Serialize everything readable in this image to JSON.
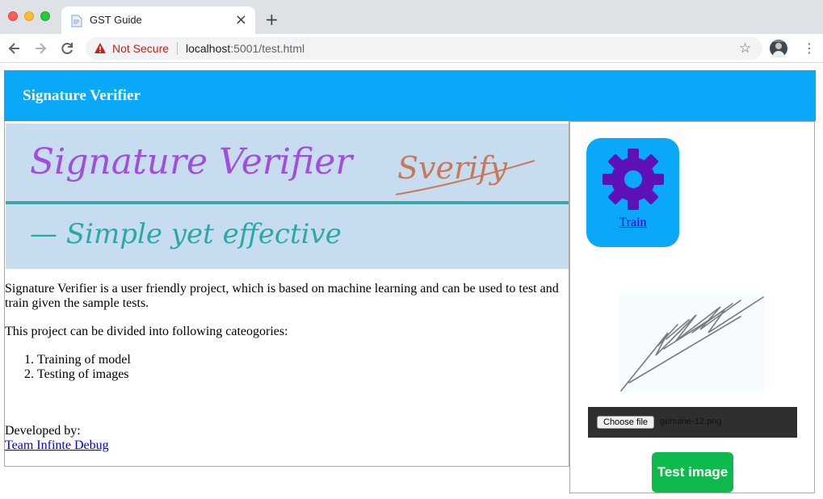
{
  "browser": {
    "tab_title": "GST Guide",
    "tab_close": "×",
    "new_tab": "+",
    "security_label": "Not Secure",
    "url_host": "localhost",
    "url_rest": ":5001/test.html",
    "bookmark_icon": "star-icon",
    "menu": "⋮"
  },
  "header": {
    "title": "Signature Verifier"
  },
  "banner": {
    "line1": "Signature Verifier",
    "signature": "Sverify",
    "line2": "— Simple  yet  effective",
    "text_color": "#a04de0",
    "line2_color": "#2aa8a8",
    "sig_color": "#c77a5a"
  },
  "main": {
    "intro": "Signature Verifier is a user friendly project, which is based on machine learning and can be used to test and train given the sample tests.",
    "categories_heading": "This project can be divided into following cateogories:",
    "categories": [
      "Training of model",
      "Testing of images"
    ],
    "developed_by": "Developed by:",
    "team_link": "Team Infinte Debug"
  },
  "side": {
    "train_label": "Train",
    "choose_file_label": "Choose file",
    "file_name": "genuine-12.png",
    "test_button": "Test image"
  },
  "colors": {
    "accent": "#0aa8f9",
    "gear": "#5e11b8",
    "test_button": "#0dba4b"
  }
}
